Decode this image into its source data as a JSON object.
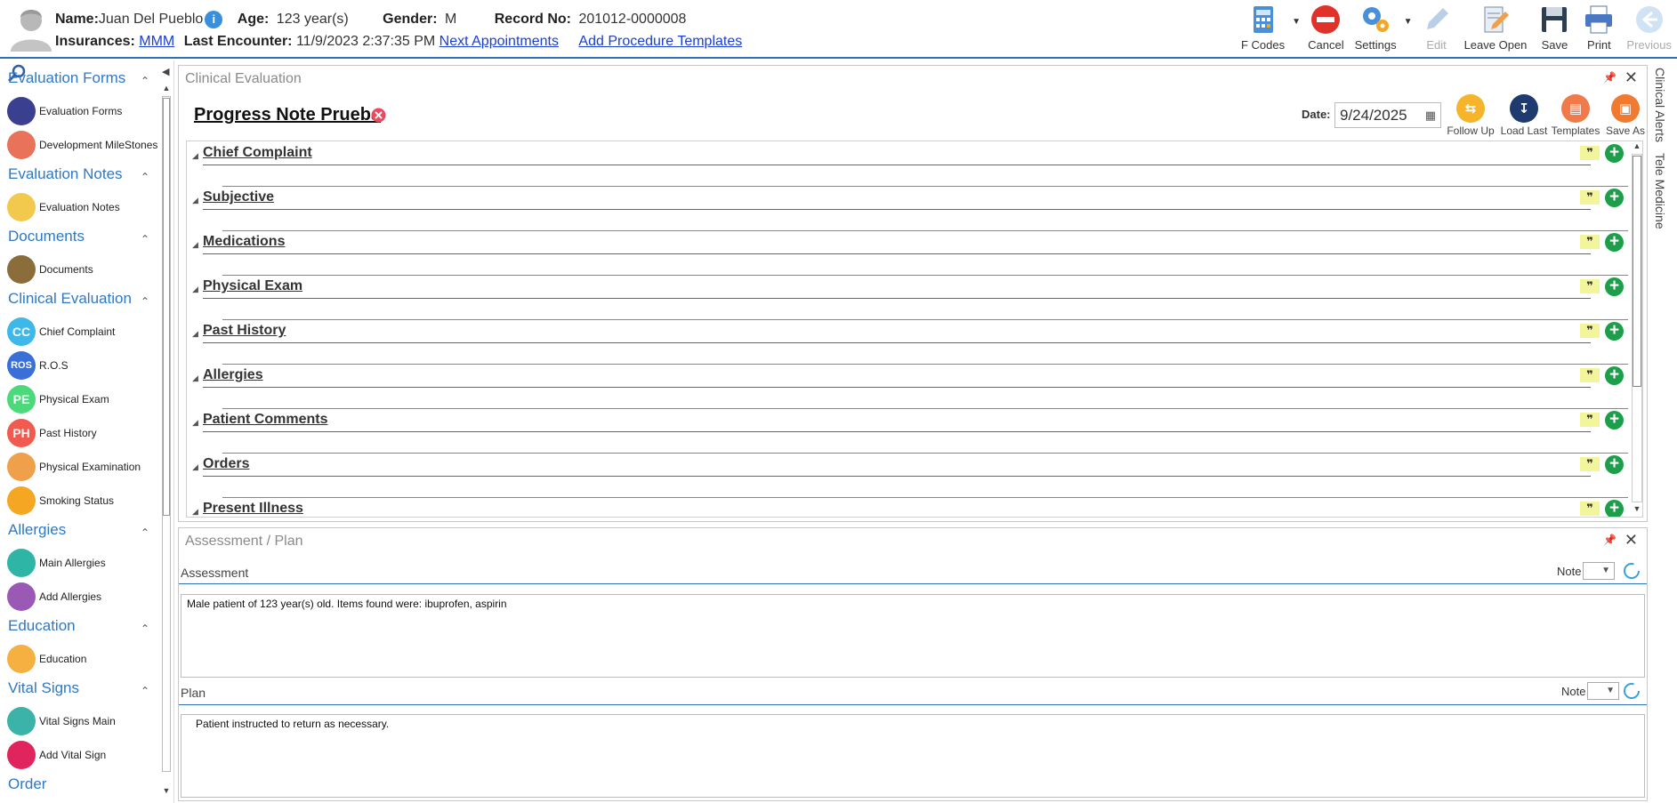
{
  "patient": {
    "name_label": "Name:",
    "name": "Juan Del Pueblo",
    "info_badge": "i",
    "age_label": "Age:",
    "age": "123 year(s)",
    "gender_label": "Gender:",
    "gender": "M",
    "record_label": "Record No:",
    "record": "201012-0000008",
    "insurances_label": "Insurances:",
    "insurance": "MMM",
    "last_encounter_label": "Last Encounter:",
    "last_encounter": "11/9/2023 2:37:35 PM",
    "next_appointments": "Next Appointments",
    "add_procedure_templates": "Add Procedure Templates"
  },
  "toolbar": [
    {
      "label": "F Codes",
      "icon": "f-codes-icon",
      "dropdown": true,
      "enabled": true
    },
    {
      "label": "Cancel",
      "icon": "cancel-icon",
      "dropdown": false,
      "enabled": true
    },
    {
      "label": "Settings",
      "icon": "settings-icon",
      "dropdown": true,
      "enabled": true
    },
    {
      "label": "Edit",
      "icon": "edit-icon",
      "dropdown": false,
      "enabled": false
    },
    {
      "label": "Leave Open",
      "icon": "leave-open-icon",
      "dropdown": false,
      "enabled": true
    },
    {
      "label": "Save",
      "icon": "save-icon",
      "dropdown": false,
      "enabled": true
    },
    {
      "label": "Print",
      "icon": "print-icon",
      "dropdown": false,
      "enabled": true
    },
    {
      "label": "Previous",
      "icon": "previous-icon",
      "dropdown": false,
      "enabled": false
    }
  ],
  "sidebar": {
    "groups": [
      {
        "title": "Evaluation Forms",
        "items": [
          {
            "label": "Evaluation Forms",
            "icon": "evaluation-forms-icon",
            "color": "#3b3f8f",
            "glyph": ""
          },
          {
            "label": "Development MileStones",
            "icon": "milestones-icon",
            "color": "#e8735a",
            "glyph": ""
          }
        ]
      },
      {
        "title": "Evaluation Notes",
        "items": [
          {
            "label": "Evaluation Notes",
            "icon": "evaluation-notes-icon",
            "color": "#f2c94c",
            "glyph": ""
          }
        ]
      },
      {
        "title": "Documents",
        "items": [
          {
            "label": "Documents",
            "icon": "documents-icon",
            "color": "#8a6d3b",
            "glyph": ""
          }
        ]
      },
      {
        "title": "Clinical Evaluation",
        "items": [
          {
            "label": "Chief Complaint",
            "icon": "chief-complaint-icon",
            "color": "#3db8e8",
            "glyph": "CC"
          },
          {
            "label": "R.O.S",
            "icon": "ros-icon",
            "color": "#3a6fd8",
            "glyph": "ROS"
          },
          {
            "label": "Physical Exam",
            "icon": "physical-exam-icon",
            "color": "#4cd97b",
            "glyph": "PE"
          },
          {
            "label": "Past History",
            "icon": "past-history-icon",
            "color": "#f05a4f",
            "glyph": "PH"
          },
          {
            "label": "Physical Examination",
            "icon": "clipboard-icon",
            "color": "#f0a04b",
            "glyph": ""
          },
          {
            "label": "Smoking Status",
            "icon": "smoking-status-icon",
            "color": "#f5a623",
            "glyph": ""
          }
        ]
      },
      {
        "title": "Allergies",
        "items": [
          {
            "label": "Main Allergies",
            "icon": "main-allergies-icon",
            "color": "#2fb5a5",
            "glyph": ""
          },
          {
            "label": "Add Allergies",
            "icon": "add-allergies-icon",
            "color": "#9b59b6",
            "glyph": ""
          }
        ]
      },
      {
        "title": "Education",
        "items": [
          {
            "label": "Education",
            "icon": "education-icon",
            "color": "#f5b041",
            "glyph": ""
          }
        ]
      },
      {
        "title": "Vital Signs",
        "items": [
          {
            "label": "Vital Signs Main",
            "icon": "vital-signs-icon",
            "color": "#3cb3a8",
            "glyph": ""
          },
          {
            "label": "Add Vital Sign",
            "icon": "add-vital-sign-icon",
            "color": "#e0245e",
            "glyph": ""
          }
        ]
      },
      {
        "title": "Order",
        "items": []
      }
    ]
  },
  "clinical_evaluation": {
    "panel_title": "Clinical Evaluation",
    "note_title": "Progress Note Prueba",
    "date_label": "Date:",
    "date_value": "9/24/2025",
    "actions": [
      {
        "label": "Follow Up",
        "icon": "follow-up-icon",
        "color": "#f5b429",
        "glyph": "⇆"
      },
      {
        "label": "Load Last",
        "icon": "load-last-icon",
        "color": "#1e3a6e",
        "glyph": "↧"
      },
      {
        "label": "Templates",
        "icon": "templates-icon",
        "color": "#f07a4a",
        "glyph": "▤"
      },
      {
        "label": "Save As",
        "icon": "save-as-icon",
        "color": "#f07a30",
        "glyph": "▣"
      }
    ],
    "sections": [
      "Chief Complaint",
      "Subjective",
      "Medications",
      "Physical Exam",
      "Past History",
      "Allergies",
      "Patient Comments",
      "Orders",
      "Present Illness"
    ],
    "quote_glyph": "❞",
    "plus_glyph": "+"
  },
  "assessment_plan": {
    "panel_title": "Assessment / Plan",
    "assessment_label": "Assessment",
    "assessment_text": "Male patient of 123 year(s) old. Items found were:  ibuprofen, aspirin",
    "plan_label": "Plan",
    "plan_text": "   Patient instructed to return as necessary.",
    "note_label": "Note"
  },
  "right_tabs": [
    "Clinical Alerts",
    "Tele Medicine"
  ],
  "colors": {
    "accent": "#2f6fb7",
    "section_add": "#1e9e4a",
    "link": "#1a3fd6"
  }
}
